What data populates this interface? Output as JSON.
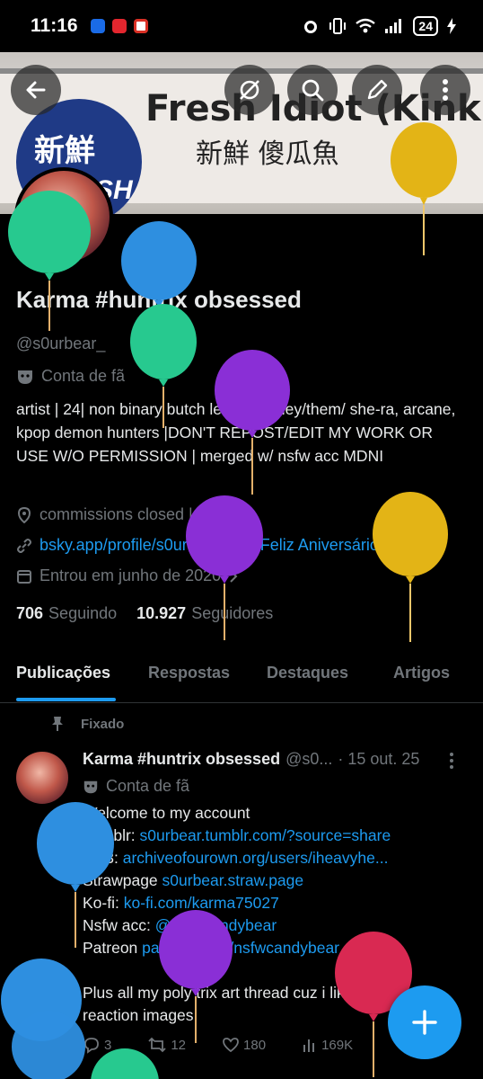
{
  "status_bar": {
    "time": "11:16",
    "battery": "24"
  },
  "banner": {
    "logo_cn": "新鮮",
    "logo_en": "FRESH",
    "title": "Fresh Idiot (Kinki)",
    "subtitle": "新鮮 傻瓜魚"
  },
  "profile": {
    "name": "Karma #huntrix obsessed",
    "handle": "@s0urbear_",
    "label": "Conta de fã",
    "bio": "artist | 24| non binary butch lesbian | they/them/ she-ra, arcane, kpop demon hunters |DON'T REPOST/EDIT MY WORK OR USE W/O PERMISSION | merged w/ nsfw acc MDNI",
    "location": "commissions closed | F CK AI",
    "website": "bsky.app/profile/s0urbe...",
    "birthday": "Feliz Aniversário!",
    "joined": "Entrou em junho de 2020",
    "following_count": "706",
    "following_label": "Seguindo",
    "followers_count": "10.927",
    "followers_label": "Seguidores"
  },
  "tabs": [
    "Publicações",
    "Respostas",
    "Destaques",
    "Artigos"
  ],
  "pinned": {
    "label": "Fixado",
    "name": "Karma #huntrix obsessed",
    "handle": "@s0...",
    "date": "· 15 out. 25",
    "account_label": "Conta de fã",
    "body": {
      "l1": "Welcome to my account",
      "l2_prefix": "Tumblr: ",
      "l2_link": "s0urbear.tumblr.com/?source=share",
      "l3_prefix": "AO3: ",
      "l3_link": "archiveofourown.org/users/iheavyhe...",
      "l4_prefix": "Strawpage ",
      "l4_link": "s0urbear.straw.page",
      "l5_prefix": "Ko-fi: ",
      "l5_link": "ko-fi.com/karma75027",
      "l6_prefix": "Nsfw acc: ",
      "l6_link": "@nsfwcandybear",
      "l7_prefix": "Patreon ",
      "l7_link": "patreon.com/nsfwcandybear",
      "l8": "Plus all my poly trix art thread cuz i like to u",
      "l9": "reaction images"
    },
    "stats": {
      "replies": "3",
      "reposts": "12",
      "likes": "180",
      "views": "169K"
    }
  },
  "colors": {
    "accent": "#1d9bf0",
    "muted": "#71767b",
    "text": "#e7e9ea",
    "balloon_blue": "#2e8fe0",
    "balloon_green": "#27c98f",
    "balloon_purple": "#8a2fd6",
    "balloon_yellow": "#e3b416",
    "balloon_red": "#d92952"
  }
}
